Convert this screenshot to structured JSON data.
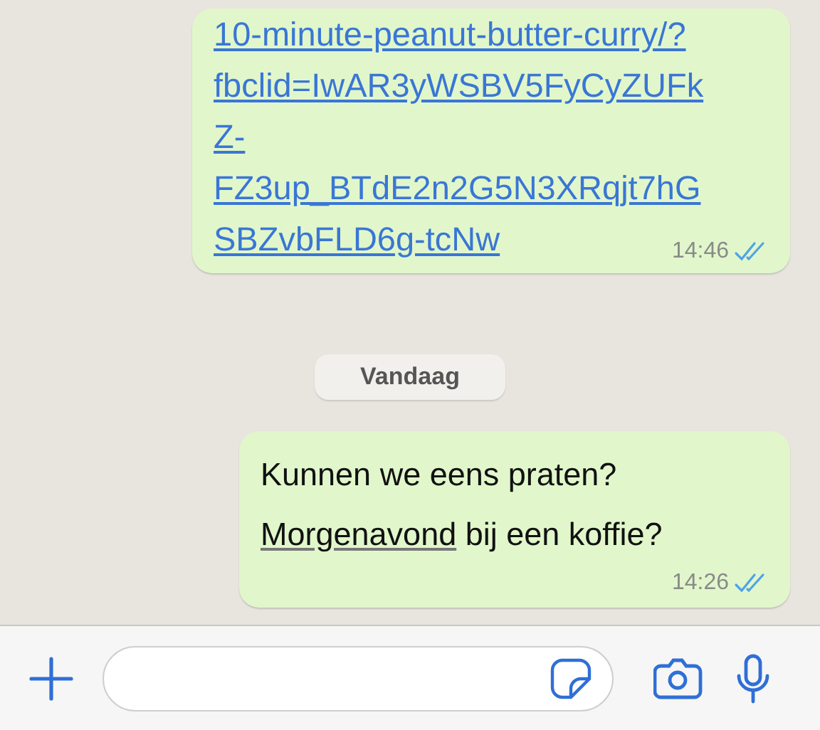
{
  "messages": [
    {
      "kind": "link",
      "lines": [
        "10-minute-peanut-butter-curry/?",
        "fbclid=IwAR3yWSBV5FyCyZUFk",
        "Z-",
        "FZ3up_BTdE2n2G5N3XRqjt7hG",
        "SBZvbFLD6g-tcNw"
      ],
      "time": "14:46",
      "read": true
    },
    {
      "kind": "date",
      "label": "Vandaag"
    },
    {
      "kind": "text",
      "link_word": "Morgenavond",
      "lines": [
        "Kunnen we eens praten?",
        " bij een koffie?"
      ],
      "time": "14:26",
      "read": true
    }
  ]
}
